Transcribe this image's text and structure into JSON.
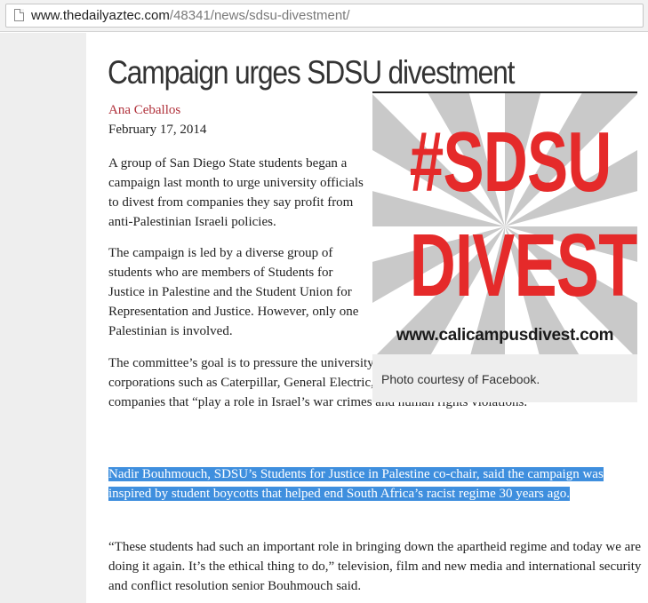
{
  "browser": {
    "url_host": "www.thedailyaztec.com",
    "url_path": "/48341/news/sdsu-divestment/"
  },
  "article": {
    "headline": "Campaign urges SDSU divestment",
    "author": "Ana Ceballos",
    "date": "February 17, 2014",
    "paragraphs": [
      "A group of San Diego State students began a campaign last month to urge university officials to divest from companies they say profit from anti-Palestinian Israeli policies.",
      "The campaign is led by a diverse group of students who are members of Students for Justice in Palestine and the Student Union for Representation and Justice. However, only one Palestinian is involved.",
      "The committee’s goal is to pressure the university’s administration to pull investments out of corporations such as Caterpillar, General Electric, Hewlett Packard and Motorola among other companies that “play a role in Israel’s war crimes and human rights violations.”",
      "Nadir Bouhmouch, SDSU’s Students for Justice in Palestine co-chair, said the campaign was inspired by student boycotts that helped end South Africa’s racist regime 30 years ago.",
      "“These students had such an important role in bringing down the apartheid regime and today we are doing it again. It’s the ethical thing to do,” television, film and new media and international security and conflict resolution senior Bouhmouch said."
    ],
    "selected_paragraph_index": 3
  },
  "figure": {
    "image_line1": "#SDSU",
    "image_line2": "DIVEST",
    "image_site": "www.calicampusdivest.com",
    "caption": "Photo courtesy of Facebook.",
    "text_color": "#e52a2a"
  },
  "colors": {
    "byline": "#b0303a",
    "selection": "#3f8fde"
  }
}
